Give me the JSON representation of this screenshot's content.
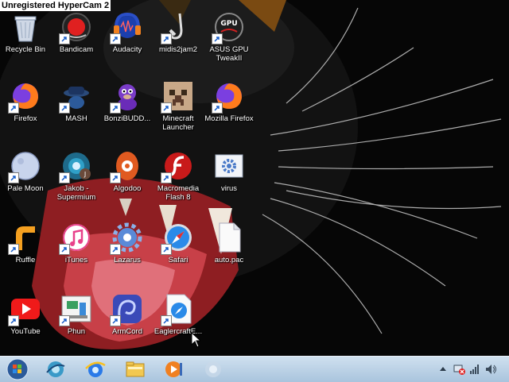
{
  "watermark": "Unregistered HyperCam 2",
  "desktop": {
    "icons": [
      {
        "label": "Recycle Bin",
        "icon": "recycle-bin-icon"
      },
      {
        "label": "Bandicam",
        "icon": "bandicam-icon"
      },
      {
        "label": "Audacity",
        "icon": "audacity-icon"
      },
      {
        "label": "midis2jam2",
        "icon": "saxophone-icon"
      },
      {
        "label": "ASUS GPU TweakII",
        "icon": "asus-gpu-tweak-icon"
      },
      {
        "label": "Firefox",
        "icon": "firefox-icon"
      },
      {
        "label": "MASH",
        "icon": "mash-icon"
      },
      {
        "label": "BonziBUDD...",
        "icon": "bonzibuddy-icon"
      },
      {
        "label": "Minecraft Launcher",
        "icon": "minecraft-icon"
      },
      {
        "label": "Mozilla Firefox",
        "icon": "firefox-icon"
      },
      {
        "label": "Pale Moon",
        "icon": "pale-moon-icon"
      },
      {
        "label": "Jakob - Supermium",
        "icon": "supermium-icon"
      },
      {
        "label": "Algodoo",
        "icon": "algodoo-icon"
      },
      {
        "label": "Macromedia Flash 8",
        "icon": "flash-icon"
      },
      {
        "label": "virus",
        "icon": "gear-file-icon"
      },
      {
        "label": "Ruffle",
        "icon": "ruffle-icon"
      },
      {
        "label": "iTunes",
        "icon": "itunes-icon"
      },
      {
        "label": "Lazarus",
        "icon": "lazarus-icon"
      },
      {
        "label": "Safari",
        "icon": "safari-icon"
      },
      {
        "label": "auto.pac",
        "icon": "blank-file-icon"
      },
      {
        "label": "YouTube",
        "icon": "youtube-icon"
      },
      {
        "label": "Phun",
        "icon": "phun-icon"
      },
      {
        "label": "ArmCord",
        "icon": "armcord-icon"
      },
      {
        "label": "EaglercraftE...",
        "icon": "eaglercraft-icon"
      }
    ]
  },
  "taskbar": {
    "items": [
      {
        "icon": "start-orb-icon"
      },
      {
        "icon": "internet-explorer-icon"
      },
      {
        "icon": "internet-explorer-icon"
      },
      {
        "icon": "file-explorer-icon"
      },
      {
        "icon": "media-player-icon"
      },
      {
        "icon": "program-icon"
      }
    ],
    "tray": [
      "show-hidden-icons-icon",
      "network-error-icon",
      "signal-icon",
      "volume-icon"
    ]
  }
}
